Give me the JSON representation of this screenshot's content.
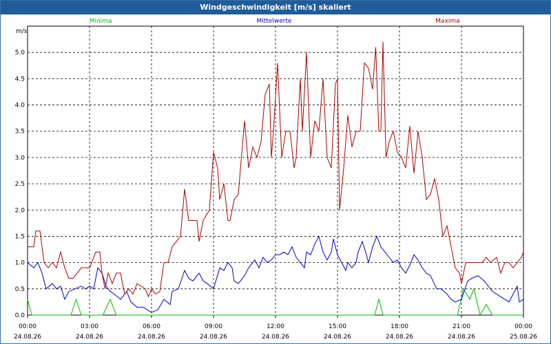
{
  "window": {
    "title": "Windgeschwindigkeit [m/s] skaliert"
  },
  "chart_data": {
    "type": "line",
    "title": "Windgeschwindigkeit [m/s] skaliert",
    "ylabel": "m/s",
    "ylim": [
      0,
      5.5
    ],
    "xlim": [
      0,
      24
    ],
    "yticks": [
      "0.0",
      "0.5",
      "1.0",
      "1.5",
      "2.0",
      "2.5",
      "3.0",
      "3.5",
      "4.0",
      "4.5",
      "5.0"
    ],
    "xticks": [
      {
        "time": "00:00",
        "date": "24.08.26"
      },
      {
        "time": "03:00",
        "date": "24.08.26"
      },
      {
        "time": "06:00",
        "date": "24.08.26"
      },
      {
        "time": "09:00",
        "date": "24.08.26"
      },
      {
        "time": "12:00",
        "date": "24.08.26"
      },
      {
        "time": "15:00",
        "date": "24.08.26"
      },
      {
        "time": "18:00",
        "date": "24.08.26"
      },
      {
        "time": "21:00",
        "date": "24.08.26"
      },
      {
        "time": "00:00",
        "date": "25.08.26"
      }
    ],
    "grid": true,
    "legend_position": "top",
    "series": [
      {
        "name": "Minima",
        "color": "#00bb00",
        "points": [
          [
            0,
            0.3
          ],
          [
            0.2,
            0
          ],
          [
            2.1,
            0
          ],
          [
            2.35,
            0.3
          ],
          [
            2.6,
            0
          ],
          [
            3.65,
            0
          ],
          [
            4.0,
            0.3
          ],
          [
            4.3,
            0
          ],
          [
            16.8,
            0
          ],
          [
            17.0,
            0.3
          ],
          [
            17.2,
            0
          ],
          [
            20.8,
            0
          ],
          [
            21.1,
            0.5
          ],
          [
            21.4,
            0.3
          ],
          [
            21.6,
            0.5
          ],
          [
            21.9,
            0
          ],
          [
            22.2,
            0.2
          ],
          [
            22.5,
            0
          ],
          [
            24,
            0
          ]
        ]
      },
      {
        "name": "Mittelwerte",
        "color": "#0000bb",
        "points": [
          [
            0,
            1.0
          ],
          [
            0.3,
            0.9
          ],
          [
            0.5,
            1.0
          ],
          [
            0.7,
            0.8
          ],
          [
            0.9,
            0.5
          ],
          [
            1.2,
            0.6
          ],
          [
            1.4,
            0.5
          ],
          [
            1.6,
            0.55
          ],
          [
            1.8,
            0.3
          ],
          [
            2.0,
            0.45
          ],
          [
            2.3,
            0.5
          ],
          [
            2.6,
            0.55
          ],
          [
            2.8,
            0.5
          ],
          [
            3.0,
            0.55
          ],
          [
            3.2,
            0.5
          ],
          [
            3.4,
            0.9
          ],
          [
            3.6,
            0.8
          ],
          [
            3.8,
            0.55
          ],
          [
            4.0,
            0.45
          ],
          [
            4.2,
            0.4
          ],
          [
            4.5,
            0.3
          ],
          [
            4.8,
            0.45
          ],
          [
            5.0,
            0.25
          ],
          [
            5.3,
            0.15
          ],
          [
            5.6,
            0.15
          ],
          [
            5.8,
            0.1
          ],
          [
            6.0,
            0.05
          ],
          [
            6.3,
            0.1
          ],
          [
            6.6,
            0.3
          ],
          [
            6.9,
            0.2
          ],
          [
            7.0,
            0.45
          ],
          [
            7.3,
            0.5
          ],
          [
            7.6,
            0.85
          ],
          [
            7.8,
            0.7
          ],
          [
            8.0,
            0.65
          ],
          [
            8.3,
            0.8
          ],
          [
            8.5,
            0.65
          ],
          [
            8.7,
            0.6
          ],
          [
            9.0,
            0.5
          ],
          [
            9.3,
            0.9
          ],
          [
            9.5,
            0.85
          ],
          [
            9.7,
            1.0
          ],
          [
            9.9,
            0.9
          ],
          [
            10.0,
            0.65
          ],
          [
            10.2,
            0.6
          ],
          [
            10.5,
            0.75
          ],
          [
            10.7,
            0.9
          ],
          [
            11.0,
            1.05
          ],
          [
            11.2,
            0.9
          ],
          [
            11.4,
            1.1
          ],
          [
            11.6,
            1.0
          ],
          [
            11.8,
            1.05
          ],
          [
            12.0,
            1.15
          ],
          [
            12.2,
            1.15
          ],
          [
            12.4,
            1.2
          ],
          [
            12.6,
            1.15
          ],
          [
            12.8,
            1.3
          ],
          [
            13.0,
            1.1
          ],
          [
            13.2,
            1.0
          ],
          [
            13.4,
            0.9
          ],
          [
            13.5,
            1.2
          ],
          [
            13.7,
            1.15
          ],
          [
            13.9,
            1.35
          ],
          [
            14.1,
            1.5
          ],
          [
            14.3,
            1.2
          ],
          [
            14.5,
            1.05
          ],
          [
            14.7,
            1.2
          ],
          [
            14.8,
            1.45
          ],
          [
            15.0,
            1.15
          ],
          [
            15.2,
            1.0
          ],
          [
            15.4,
            0.85
          ],
          [
            15.5,
            1.0
          ],
          [
            15.7,
            0.9
          ],
          [
            15.9,
            1.0
          ],
          [
            16.0,
            1.2
          ],
          [
            16.2,
            1.4
          ],
          [
            16.4,
            1.15
          ],
          [
            16.5,
            1.0
          ],
          [
            16.7,
            1.3
          ],
          [
            16.9,
            1.5
          ],
          [
            17.1,
            1.3
          ],
          [
            17.3,
            1.2
          ],
          [
            17.5,
            1.1
          ],
          [
            17.7,
            1.0
          ],
          [
            17.9,
            1.05
          ],
          [
            18.1,
            0.9
          ],
          [
            18.3,
            0.8
          ],
          [
            18.5,
            0.95
          ],
          [
            18.7,
            1.15
          ],
          [
            18.9,
            1.05
          ],
          [
            19.1,
            0.9
          ],
          [
            19.3,
            0.8
          ],
          [
            19.5,
            0.75
          ],
          [
            19.8,
            0.5
          ],
          [
            20.0,
            0.5
          ],
          [
            20.3,
            0.4
          ],
          [
            20.5,
            0.3
          ],
          [
            20.7,
            0.25
          ],
          [
            21.0,
            0.3
          ],
          [
            21.3,
            0.65
          ],
          [
            21.5,
            0.7
          ],
          [
            21.8,
            0.75
          ],
          [
            22.1,
            0.65
          ],
          [
            22.3,
            0.55
          ],
          [
            22.5,
            0.45
          ],
          [
            22.7,
            0.4
          ],
          [
            22.9,
            0.35
          ],
          [
            23.1,
            0.3
          ],
          [
            23.3,
            0.25
          ],
          [
            23.5,
            0.4
          ],
          [
            23.7,
            0.55
          ],
          [
            23.8,
            0.25
          ],
          [
            24,
            0.3
          ]
        ]
      },
      {
        "name": "Maxima",
        "color": "#aa0000",
        "points": [
          [
            0,
            1.3
          ],
          [
            0.3,
            1.3
          ],
          [
            0.4,
            1.6
          ],
          [
            0.6,
            1.6
          ],
          [
            0.7,
            1.3
          ],
          [
            0.8,
            1.0
          ],
          [
            1.0,
            0.9
          ],
          [
            1.2,
            1.0
          ],
          [
            1.4,
            0.9
          ],
          [
            1.6,
            1.2
          ],
          [
            1.8,
            0.9
          ],
          [
            2.0,
            0.7
          ],
          [
            2.2,
            0.7
          ],
          [
            2.4,
            0.8
          ],
          [
            2.6,
            0.9
          ],
          [
            3.0,
            0.9
          ],
          [
            3.3,
            1.2
          ],
          [
            3.5,
            1.2
          ],
          [
            3.6,
            0.8
          ],
          [
            3.75,
            0.5
          ],
          [
            3.9,
            0.8
          ],
          [
            4.1,
            0.6
          ],
          [
            4.3,
            0.8
          ],
          [
            4.5,
            0.8
          ],
          [
            4.7,
            0.4
          ],
          [
            4.9,
            0.5
          ],
          [
            5.1,
            0.4
          ],
          [
            5.3,
            0.6
          ],
          [
            5.5,
            0.55
          ],
          [
            5.7,
            0.5
          ],
          [
            5.85,
            0.35
          ],
          [
            6.0,
            0.5
          ],
          [
            6.2,
            0.4
          ],
          [
            6.4,
            0.45
          ],
          [
            6.6,
            1.0
          ],
          [
            6.8,
            1.0
          ],
          [
            7.0,
            1.3
          ],
          [
            7.2,
            1.4
          ],
          [
            7.4,
            1.5
          ],
          [
            7.6,
            2.4
          ],
          [
            7.8,
            1.8
          ],
          [
            8.0,
            1.8
          ],
          [
            8.2,
            1.8
          ],
          [
            8.3,
            1.4
          ],
          [
            8.5,
            1.8
          ],
          [
            8.8,
            2.0
          ],
          [
            9.0,
            3.1
          ],
          [
            9.2,
            2.8
          ],
          [
            9.3,
            2.2
          ],
          [
            9.5,
            2.5
          ],
          [
            9.7,
            1.8
          ],
          [
            9.8,
            1.8
          ],
          [
            10.0,
            2.2
          ],
          [
            10.2,
            2.3
          ],
          [
            10.5,
            3.7
          ],
          [
            10.7,
            2.8
          ],
          [
            10.9,
            3.2
          ],
          [
            11.1,
            3.0
          ],
          [
            11.3,
            3.3
          ],
          [
            11.5,
            4.2
          ],
          [
            11.7,
            4.4
          ],
          [
            11.8,
            3.0
          ],
          [
            11.9,
            3.5
          ],
          [
            12.1,
            4.8
          ],
          [
            12.3,
            3.0
          ],
          [
            12.5,
            3.5
          ],
          [
            12.7,
            3.5
          ],
          [
            12.9,
            2.8
          ],
          [
            13.0,
            3.0
          ],
          [
            13.2,
            4.5
          ],
          [
            13.3,
            3.5
          ],
          [
            13.5,
            5.0
          ],
          [
            13.7,
            3.0
          ],
          [
            13.9,
            3.7
          ],
          [
            14.1,
            3.5
          ],
          [
            14.3,
            4.5
          ],
          [
            14.5,
            3.0
          ],
          [
            14.7,
            2.8
          ],
          [
            14.9,
            4.4
          ],
          [
            15.0,
            4.5
          ],
          [
            15.1,
            2.0
          ],
          [
            15.3,
            2.8
          ],
          [
            15.5,
            3.8
          ],
          [
            15.7,
            3.2
          ],
          [
            15.9,
            3.5
          ],
          [
            16.1,
            3.5
          ],
          [
            16.3,
            4.8
          ],
          [
            16.5,
            4.7
          ],
          [
            16.7,
            4.3
          ],
          [
            16.85,
            5.1
          ],
          [
            17.0,
            3.5
          ],
          [
            17.1,
            3.5
          ],
          [
            17.2,
            5.2
          ],
          [
            17.35,
            3.0
          ],
          [
            17.5,
            3.3
          ],
          [
            17.7,
            3.5
          ],
          [
            17.9,
            3.1
          ],
          [
            18.1,
            3.0
          ],
          [
            18.3,
            2.8
          ],
          [
            18.5,
            3.6
          ],
          [
            18.7,
            2.7
          ],
          [
            18.9,
            3.5
          ],
          [
            19.1,
            3.0
          ],
          [
            19.3,
            2.2
          ],
          [
            19.5,
            2.3
          ],
          [
            19.7,
            2.6
          ],
          [
            19.9,
            2.2
          ],
          [
            20.1,
            1.5
          ],
          [
            20.3,
            1.7
          ],
          [
            20.5,
            1.3
          ],
          [
            20.7,
            0.9
          ],
          [
            20.9,
            0.8
          ],
          [
            21.0,
            0.6
          ],
          [
            21.2,
            1.0
          ],
          [
            21.4,
            1.0
          ],
          [
            21.7,
            1.0
          ],
          [
            22.0,
            1.0
          ],
          [
            22.2,
            1.1
          ],
          [
            22.4,
            1.0
          ],
          [
            22.7,
            1.1
          ],
          [
            22.9,
            0.8
          ],
          [
            23.1,
            1.0
          ],
          [
            23.3,
            1.0
          ],
          [
            23.5,
            0.9
          ],
          [
            23.7,
            1.0
          ],
          [
            23.9,
            1.1
          ],
          [
            24.0,
            1.2
          ]
        ]
      }
    ]
  }
}
